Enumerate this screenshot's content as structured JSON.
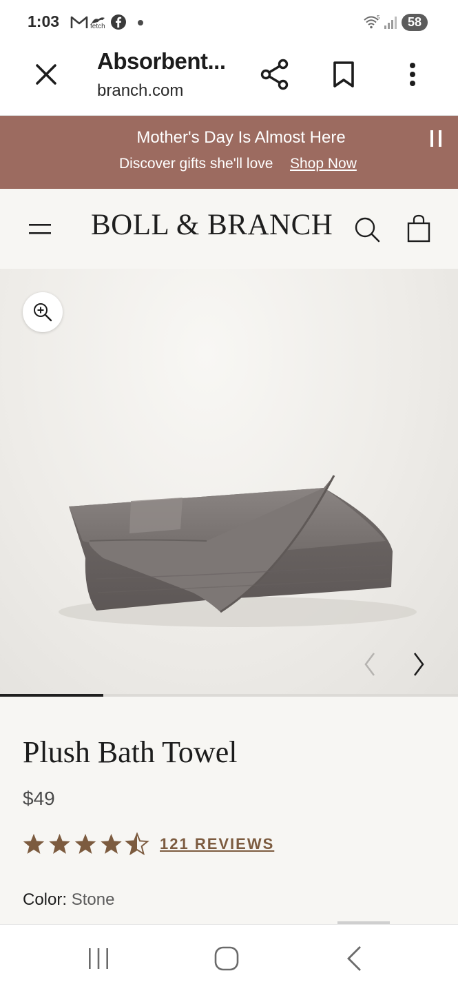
{
  "status_bar": {
    "time": "1:03",
    "fetch_label": "fetch",
    "battery_level": "58",
    "icons": [
      "gmail-icon",
      "fetch-icon",
      "facebook-icon",
      "notification-dot-icon",
      "wifi-icon",
      "signal-icon",
      "battery-icon"
    ]
  },
  "browser": {
    "page_title": "Absorbent...",
    "url": "branch.com",
    "close_icon": "close-icon",
    "share_icon": "share-icon",
    "bookmark_icon": "bookmark-icon",
    "menu_icon": "more-vert-icon"
  },
  "promo": {
    "title": "Mother's Day Is Almost Here",
    "subtitle": "Discover gifts she'll love",
    "link": "Shop Now",
    "background": "#9c6b60"
  },
  "site_header": {
    "logo": "BOLL & BRANCH",
    "menu_icon": "hamburger-icon",
    "search_icon": "search-icon",
    "cart_icon": "shopping-bag-icon"
  },
  "gallery": {
    "zoom_icon": "zoom-in-icon",
    "prev_icon": "chevron-left-icon",
    "next_icon": "chevron-right-icon",
    "progress_fraction": 0.225
  },
  "product": {
    "name": "Plush Bath Towel",
    "price": "$49",
    "rating": 4.5,
    "rating_max": 5,
    "reviews": "121 REVIEWS",
    "color_label": "Color:",
    "color_value": "Stone",
    "star_color": "#7c5b3f"
  },
  "nav_bar": {
    "recent_icon": "recent-apps-icon",
    "home_icon": "home-icon",
    "back_icon": "back-icon"
  }
}
